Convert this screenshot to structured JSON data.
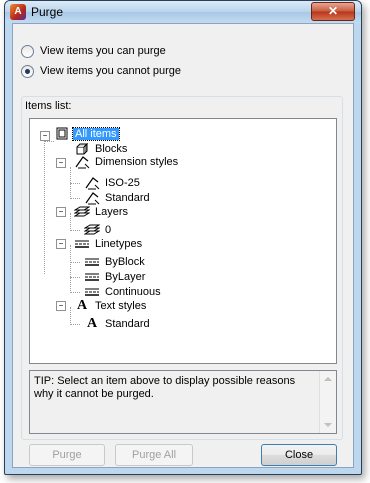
{
  "window": {
    "title": "Purge",
    "close_glyph": "✕"
  },
  "options": [
    {
      "label": "View items you can purge",
      "checked": false
    },
    {
      "label": "View items you cannot purge",
      "checked": true
    }
  ],
  "items_list": {
    "label": "Items list:",
    "root": "All items",
    "blocks": "Blocks",
    "dimension_styles": "Dimension styles",
    "dim_iso": "ISO-25",
    "dim_standard": "Standard",
    "layers": "Layers",
    "layer_0": "0",
    "linetypes": "Linetypes",
    "lt_byblock": "ByBlock",
    "lt_bylayer": "ByLayer",
    "lt_continuous": "Continuous",
    "text_styles": "Text styles",
    "ts_standard": "Standard"
  },
  "tip": "TIP: Select an item above to display possible reasons why it cannot be purged.",
  "buttons": {
    "purge": "Purge",
    "purge_all": "Purge All",
    "close": "Close"
  }
}
